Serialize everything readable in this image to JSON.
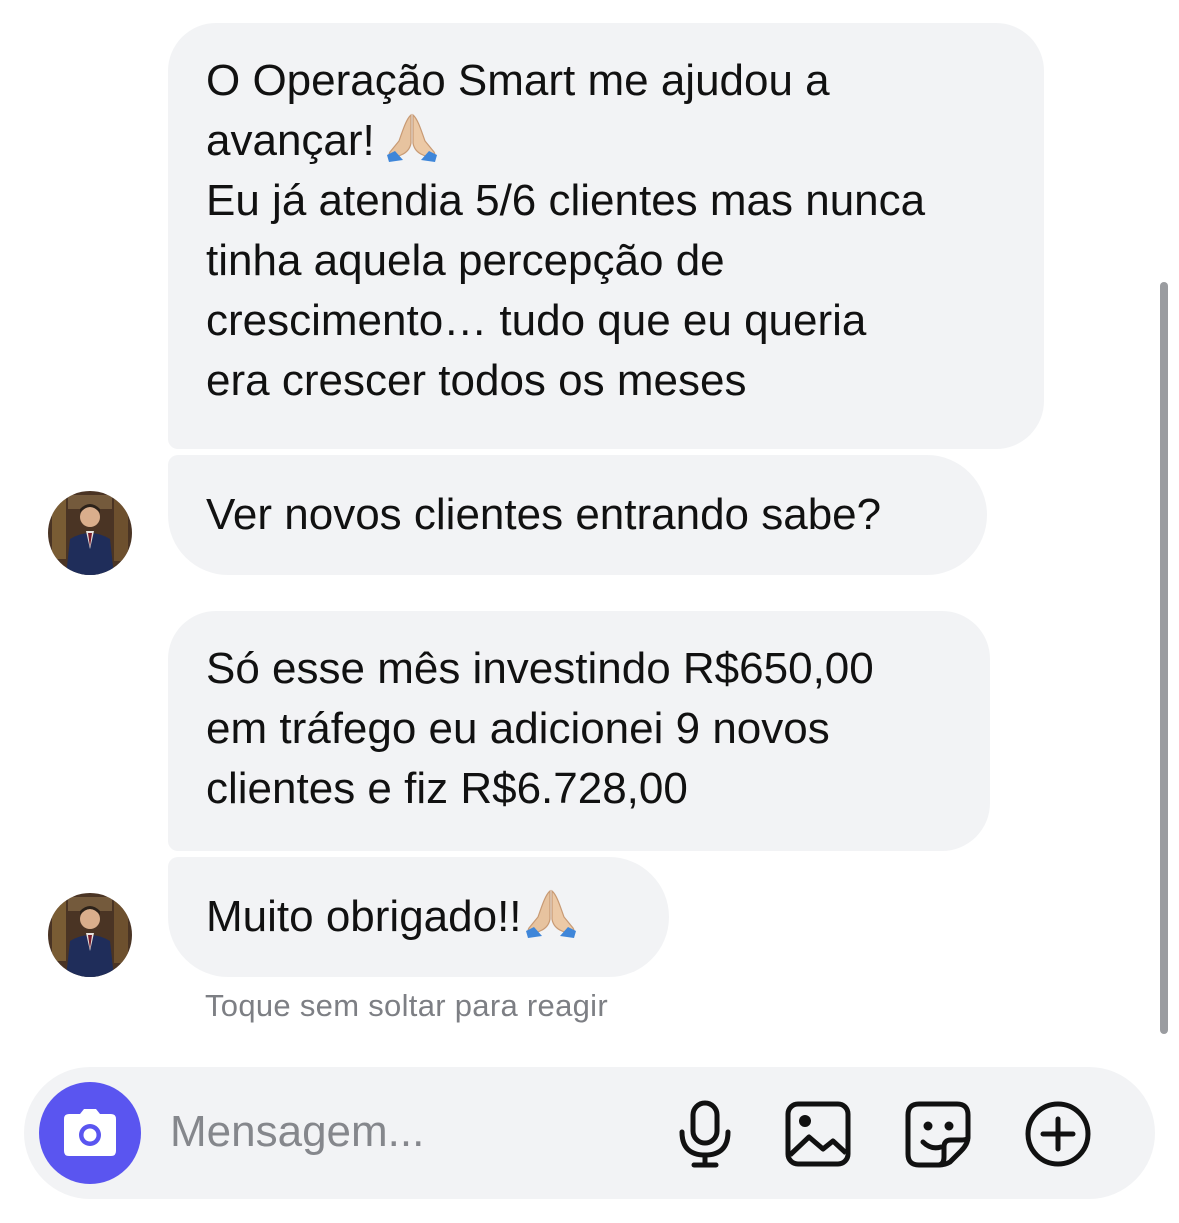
{
  "messages": [
    {
      "lines": [
        "O Operação Smart me ajudou a",
        "avançar!",
        "Eu já atendia 5/6 clientes mas nunca",
        "tinha aquela percepção de",
        "crescimento… tudo que eu queria",
        "era crescer todos os meses"
      ],
      "emoji": "folded-hands"
    },
    {
      "lines": [
        "Ver novos clientes entrando sabe?"
      ]
    },
    {
      "lines": [
        "Só esse mês investindo R$650,00",
        "em tráfego eu adicionei 9 novos",
        "clientes e fiz R$6.728,00"
      ]
    },
    {
      "lines": [
        "Muito obrigado!!"
      ],
      "emoji": "folded-hands"
    }
  ],
  "hint": "Toque sem soltar para reagir",
  "composer": {
    "placeholder": "Mensagem...",
    "icons": [
      "camera-icon",
      "microphone-icon",
      "gallery-icon",
      "sticker-icon",
      "plus-icon"
    ]
  },
  "colors": {
    "bubble": "#f2f3f5",
    "camera_button": "#5a55f0",
    "hint_text": "#7d7f84",
    "scrollbar": "#9a9ca0"
  }
}
